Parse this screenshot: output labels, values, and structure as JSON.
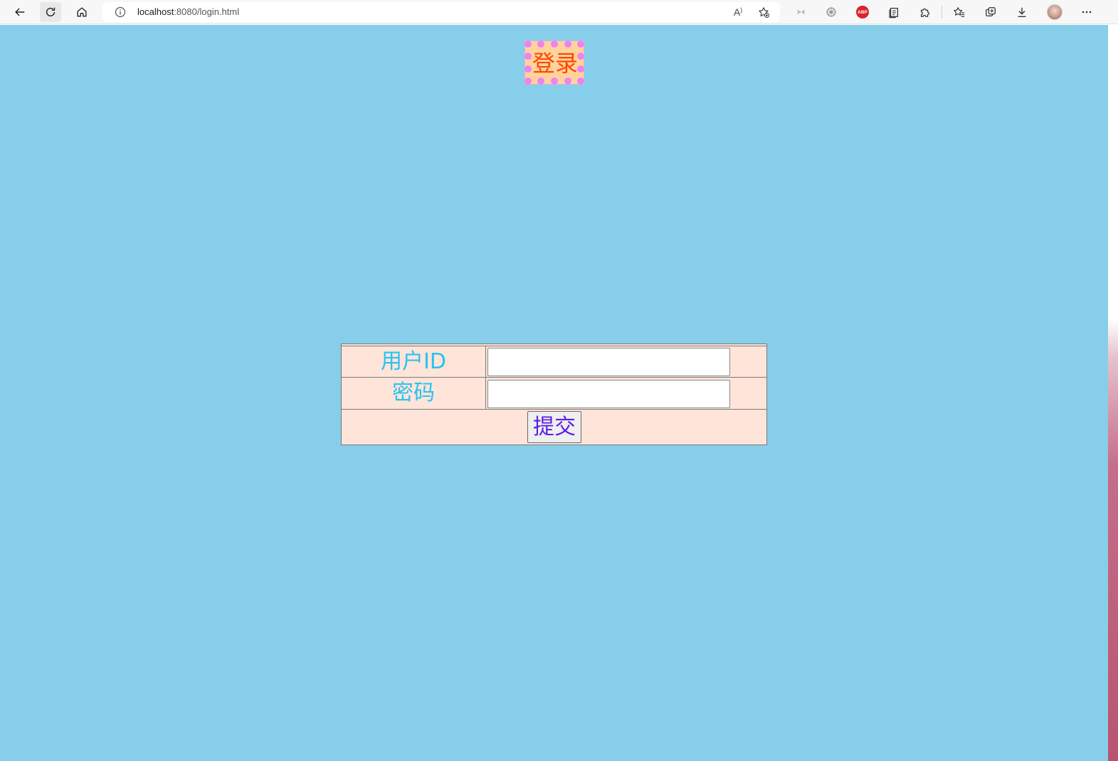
{
  "browser": {
    "url_host": "localhost",
    "url_rest": ":8080/login.html",
    "read_aloud_label": "A",
    "abp_label": "ABP"
  },
  "page": {
    "title": "登录",
    "background_color": "#87ceeb",
    "title_color": "#ff4500",
    "title_bg_color": "#ffd39b",
    "dot_color": "#ee82ee",
    "table_bg_color": "#ffe4d9",
    "label_color": "#27c3f0",
    "button_text_color": "#5a1ee6"
  },
  "login_form": {
    "user_id_label": "用户ID",
    "user_id_value": "",
    "password_label": "密码",
    "password_value": "",
    "submit_label": "提交"
  }
}
